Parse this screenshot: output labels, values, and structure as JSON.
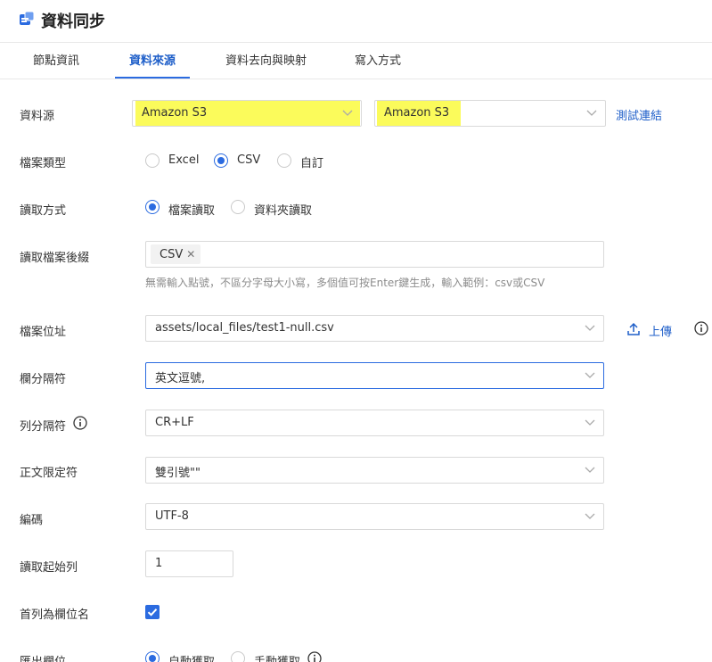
{
  "header": {
    "title": "資料同步",
    "icon": "sync-app-icon"
  },
  "tabs": [
    {
      "label": "節點資訊",
      "active": false
    },
    {
      "label": "資料來源",
      "active": true
    },
    {
      "label": "資料去向與映射",
      "active": false
    },
    {
      "label": "寫入方式",
      "active": false
    }
  ],
  "form": {
    "datasource": {
      "label": "資料源",
      "type_value": "Amazon S3",
      "instance_value": "Amazon S3",
      "test_link": "測試連結"
    },
    "file_type": {
      "label": "檔案類型",
      "options": [
        "Excel",
        "CSV",
        "自訂"
      ],
      "selected": "CSV"
    },
    "read_mode": {
      "label": "讀取方式",
      "options": [
        "檔案讀取",
        "資料夾讀取"
      ],
      "selected": "檔案讀取"
    },
    "suffix": {
      "label": "讀取檔案後綴",
      "tags": [
        "CSV"
      ],
      "hint": "無需輸入點號，不區分字母大小寫，多個值可按Enter鍵生成，輸入範例：csv或CSV"
    },
    "file_path": {
      "label": "檔案位址",
      "value": "assets/local_files/test1-null.csv",
      "upload_label": "上傳"
    },
    "field_separator": {
      "label": "欄分隔符",
      "value": "英文逗號,"
    },
    "row_separator": {
      "label": "列分隔符",
      "value": "CR+LF"
    },
    "text_qualifier": {
      "label": "正文限定符",
      "value": "雙引號\"\""
    },
    "encoding": {
      "label": "編碼",
      "value": "UTF-8"
    },
    "start_row": {
      "label": "讀取起始列",
      "value": "1"
    },
    "header_row": {
      "label": "首列為欄位名",
      "checked": true
    },
    "output_fields": {
      "label": "匯出欄位",
      "options": [
        "自動獲取",
        "手動獲取"
      ],
      "selected": "自動獲取"
    }
  },
  "colors": {
    "accent": "#2b6be0",
    "highlight": "#fbfb5b",
    "link": "#1f5fc9"
  }
}
